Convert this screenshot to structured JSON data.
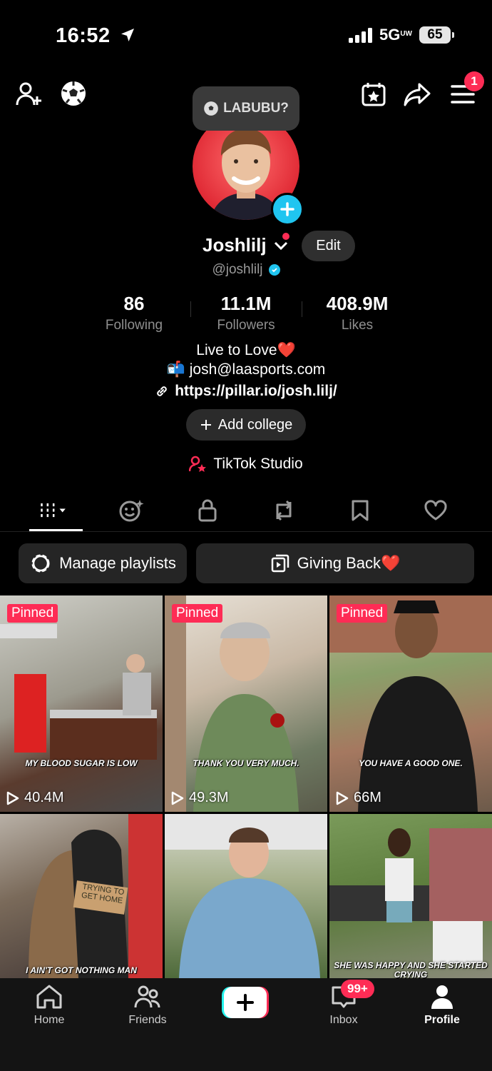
{
  "status_bar": {
    "time": "16:52",
    "network": "5G",
    "network_suffix": "UW",
    "battery": "65"
  },
  "header": {
    "menu_badge": "1",
    "labubu_label": "LABUBU?"
  },
  "profile": {
    "display_name": "Joshlilj",
    "edit_label": "Edit",
    "handle": "@joshlilj",
    "stats": [
      {
        "value": "86",
        "label": "Following"
      },
      {
        "value": "11.1M",
        "label": "Followers"
      },
      {
        "value": "408.9M",
        "label": "Likes"
      }
    ],
    "bio_line": "Live to Love❤️",
    "email_emoji": "📬",
    "email": "josh@laasports.com",
    "link": "https://pillar.io/josh.lilj/",
    "add_college_label": "Add college",
    "studio_label": "TikTok Studio"
  },
  "buttons": {
    "manage_playlists": "Manage playlists",
    "giving_back": "Giving Back❤️"
  },
  "videos": [
    {
      "pinned": "Pinned",
      "caption": "MY BLOOD SUGAR IS LOW",
      "views": "40.4M"
    },
    {
      "pinned": "Pinned",
      "caption": "THANK YOU VERY MUCH.",
      "views": "49.3M"
    },
    {
      "pinned": "Pinned",
      "caption": "YOU HAVE A GOOD ONE.",
      "views": "66M"
    },
    {
      "caption": "I AIN'T GOT NOTHING MAN",
      "sign_text": "TRYING TO GET HOME"
    },
    {
      "caption": ""
    },
    {
      "caption": "SHE WAS HAPPY AND SHE STARTED CRYING"
    }
  ],
  "nav": {
    "home": "Home",
    "friends": "Friends",
    "inbox": "Inbox",
    "inbox_badge": "99+",
    "profile": "Profile"
  },
  "colors": {
    "accent": "#fe2c55",
    "cyan": "#20c5f0"
  }
}
